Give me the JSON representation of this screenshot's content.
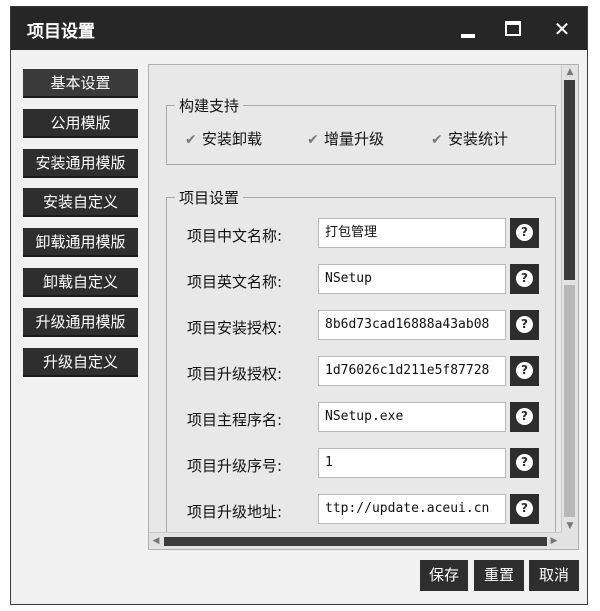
{
  "window": {
    "title": "项目设置"
  },
  "nav": {
    "items": [
      {
        "label": "基本设置"
      },
      {
        "label": "公用模版"
      },
      {
        "label": "安装通用模版"
      },
      {
        "label": "安装自定义"
      },
      {
        "label": "卸载通用模版"
      },
      {
        "label": "卸载自定义"
      },
      {
        "label": "升级通用模版"
      },
      {
        "label": "升级自定义"
      }
    ],
    "active_index": 0
  },
  "build_support": {
    "legend": "构建支持",
    "options": [
      {
        "label": "安装卸载",
        "checked": true
      },
      {
        "label": "增量升级",
        "checked": true
      },
      {
        "label": "安装统计",
        "checked": true
      }
    ]
  },
  "project_settings": {
    "legend": "项目设置",
    "fields": [
      {
        "label": "项目中文名称:",
        "value": "打包管理"
      },
      {
        "label": "项目英文名称:",
        "value": "NSetup"
      },
      {
        "label": "项目安装授权:",
        "value": "8b6d73cad16888a43ab08"
      },
      {
        "label": "项目升级授权:",
        "value": "1d76026c1d211e5f87728"
      },
      {
        "label": "项目主程序名:",
        "value": "NSetup.exe"
      },
      {
        "label": "项目升级序号:",
        "value": "1"
      },
      {
        "label": "项目升级地址:",
        "value": "ttp://update.aceui.cn"
      }
    ],
    "help_glyph": "?"
  },
  "footer": {
    "save_label": "保存",
    "reset_label": "重置",
    "cancel_label": "取消"
  },
  "icons": {
    "minimize": "minimize-icon",
    "maximize": "maximize-icon",
    "close": "close-icon",
    "help": "help-icon",
    "check": "checkmark-icon"
  },
  "colors": {
    "titlebar": "#262626",
    "nav_button": "#2e2e2e",
    "panel": "#e8e8e8"
  }
}
